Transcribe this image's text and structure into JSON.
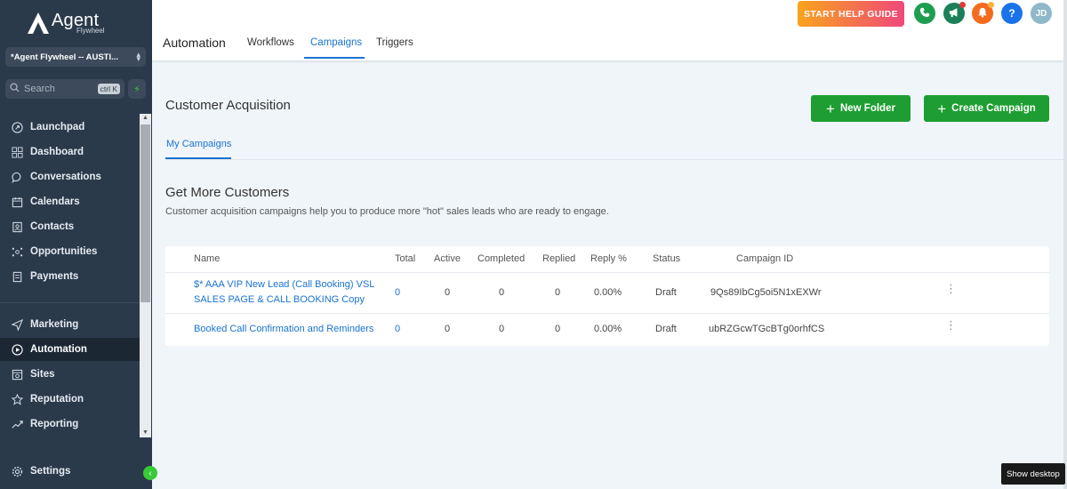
{
  "brand": {
    "name": "Agent",
    "sub": "Flywheel"
  },
  "account": {
    "label": "*Agent Flywheel -- AUSTI..."
  },
  "search": {
    "placeholder": "Search",
    "shortcut": "ctrl K"
  },
  "sidebar": {
    "items": [
      {
        "label": "Launchpad",
        "icon": "launchpad-icon"
      },
      {
        "label": "Dashboard",
        "icon": "dashboard-icon"
      },
      {
        "label": "Conversations",
        "icon": "chat-icon"
      },
      {
        "label": "Calendars",
        "icon": "calendar-icon"
      },
      {
        "label": "Contacts",
        "icon": "contacts-icon"
      },
      {
        "label": "Opportunities",
        "icon": "opportunities-icon"
      },
      {
        "label": "Payments",
        "icon": "payments-icon"
      },
      {
        "label": "Marketing",
        "icon": "send-icon"
      },
      {
        "label": "Automation",
        "icon": "automation-icon"
      },
      {
        "label": "Sites",
        "icon": "sites-icon"
      },
      {
        "label": "Reputation",
        "icon": "star-icon"
      },
      {
        "label": "Reporting",
        "icon": "trend-icon"
      }
    ],
    "settings": "Settings"
  },
  "header": {
    "title": "Automation",
    "tabs": [
      "Workflows",
      "Campaigns",
      "Triggers"
    ],
    "help_label": "START HELP GUIDE",
    "avatar": "JD",
    "help_icon_label": "?"
  },
  "main": {
    "section_title": "Customer Acquisition",
    "new_folder": "New Folder",
    "create_campaign": "Create Campaign",
    "subtab": "My Campaigns",
    "heading": "Get More Customers",
    "description": "Customer acquisition campaigns help you to produce more \"hot\" sales leads who are ready to engage."
  },
  "table": {
    "columns": [
      "Name",
      "Total",
      "Active",
      "Completed",
      "Replied",
      "Reply %",
      "Status",
      "Campaign ID"
    ],
    "rows": [
      {
        "name_line1": "$* AAA VIP New Lead (Call Booking) VSL",
        "name_line2": "SALES PAGE & CALL BOOKING Copy",
        "total": "0",
        "active": "0",
        "completed": "0",
        "replied": "0",
        "reply_pct": "0.00%",
        "status": "Draft",
        "campaign_id": "9Qs89IbCg5oi5N1xEXWr"
      },
      {
        "name_line1": "Booked Call Confirmation and Reminders",
        "name_line2": "",
        "total": "0",
        "active": "0",
        "completed": "0",
        "replied": "0",
        "reply_pct": "0.00%",
        "status": "Draft",
        "campaign_id": "ubRZGcwTGcBTg0orhfCS"
      }
    ]
  },
  "taskbar": {
    "show_desktop": "Show desktop"
  },
  "colors": {
    "accent": "#1a73d0",
    "green": "#1e9e32",
    "sidebar": "#2b3a4b"
  }
}
